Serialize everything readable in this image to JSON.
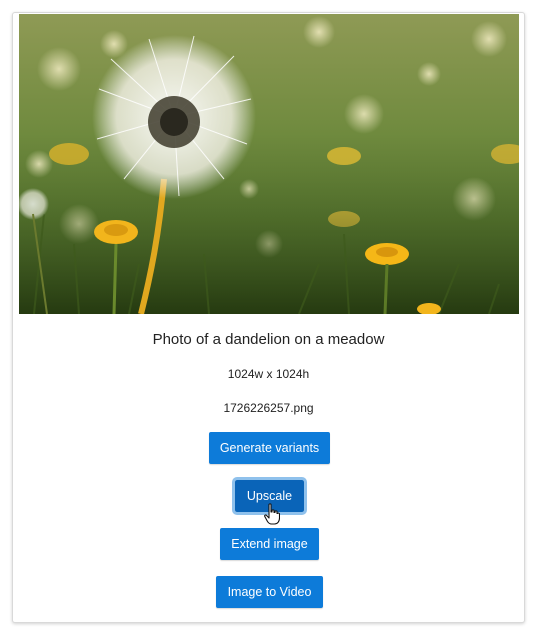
{
  "card": {
    "image_alt": "Photo of a dandelion on a meadow",
    "caption": "Photo of a dandelion on a meadow",
    "dimensions": "1024w x 1024h",
    "filename": "1726226257.png"
  },
  "actions": {
    "generate_variants": "Generate variants",
    "upscale": "Upscale",
    "extend_image": "Extend image",
    "image_to_video": "Image to Video"
  },
  "colors": {
    "button": "#0d7bd9",
    "button_active": "#0a64b8",
    "focus_ring": "#8fc1ec"
  },
  "icons": {
    "cursor": "hand-pointer-icon"
  }
}
